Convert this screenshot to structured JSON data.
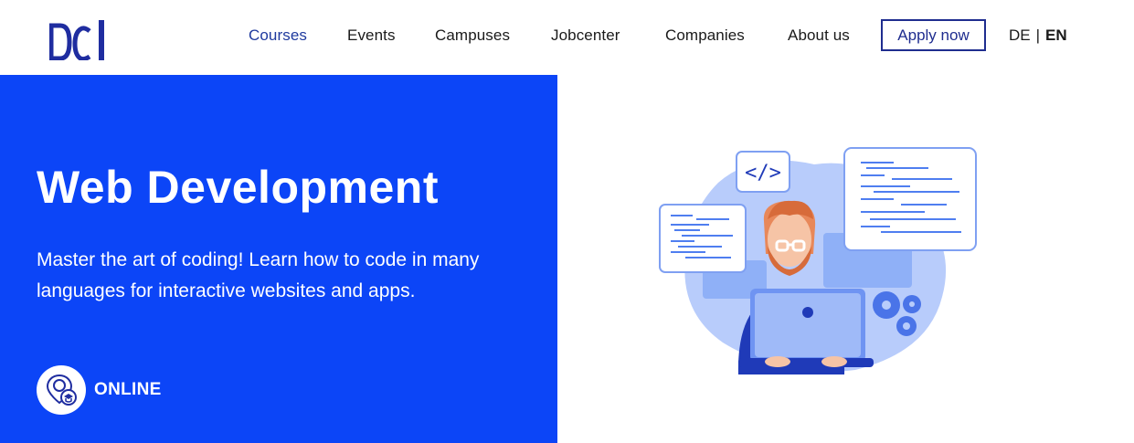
{
  "header": {
    "logo_text": "DCI",
    "nav": [
      {
        "label": "Courses",
        "active": true
      },
      {
        "label": "Events"
      },
      {
        "label": "Campuses"
      },
      {
        "label": "Jobcenter"
      },
      {
        "label": "Companies"
      },
      {
        "label": "About us"
      }
    ],
    "apply_label": "Apply now",
    "lang": {
      "de": "DE",
      "sep": "|",
      "en": "EN"
    }
  },
  "hero": {
    "title": "Web Development",
    "subtitle": "Master the art of coding! Learn how to code in many languages for interactive websites and apps.",
    "badge_label": "ONLINE",
    "code_tag": "</>"
  },
  "colors": {
    "brand_blue": "#0c45f7",
    "nav_active": "#1f3a9e",
    "apply_border": "#1f2d8f"
  },
  "icons": [
    "dci-logo",
    "online-location-icon",
    "developer-illustration"
  ]
}
